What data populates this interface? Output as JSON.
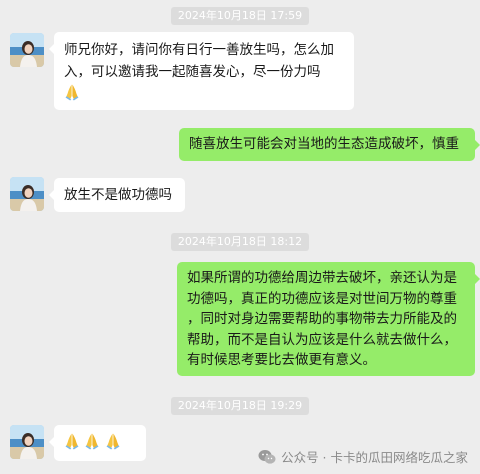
{
  "colors": {
    "background": "#ededed",
    "bubble_out": "#95ec69",
    "bubble_in": "#ffffff",
    "timestamp_bg": "#dcdcdc"
  },
  "messages": [
    {
      "type": "timestamp",
      "text": "2024年10月18日 17:59"
    },
    {
      "type": "incoming",
      "sender_icon": "avatar",
      "lines": [
        "师兄你好，请问你有日行一善放生吗，怎么加",
        "入，可以邀请我一起随喜发心，尽一份力吗"
      ],
      "emoji": [
        "folded-hands-icon"
      ]
    },
    {
      "type": "outgoing",
      "text": "随喜放生可能会对当地的生态造成破坏，慎重"
    },
    {
      "type": "incoming",
      "sender_icon": "avatar",
      "text": "放生不是做功德吗"
    },
    {
      "type": "timestamp",
      "text": "2024年10月18日 18:12"
    },
    {
      "type": "outgoing",
      "lines": [
        "如果所谓的功德给周边带去破坏，亲还认为是",
        "功德吗，真正的功德应该是对世间万物的尊重",
        "，同时对身边需要帮助的事物带去力所能及的",
        "帮助，而不是自认为应该是什么就去做什么，",
        "有时候思考要比去做更有意义。"
      ]
    },
    {
      "type": "timestamp",
      "text": "2024年10月18日 19:29"
    },
    {
      "type": "incoming",
      "sender_icon": "avatar",
      "emoji": [
        "folded-hands-icon",
        "folded-hands-icon",
        "folded-hands-icon"
      ]
    }
  ],
  "watermark": {
    "icon": "wechat-icon",
    "text": "公众号 · 卡卡的瓜田网络吃瓜之家"
  }
}
